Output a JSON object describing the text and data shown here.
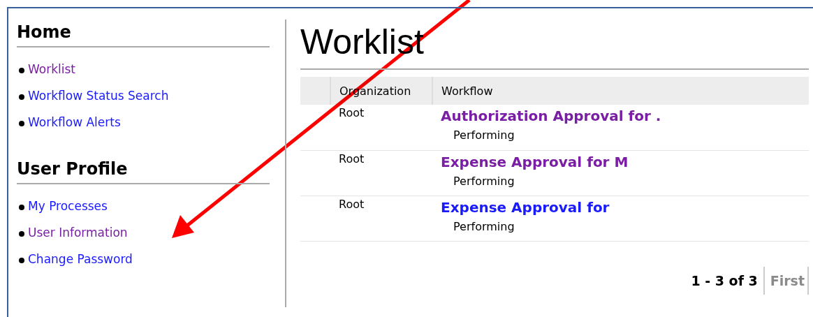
{
  "sidebar": {
    "sections": [
      {
        "heading": "Home",
        "links": [
          {
            "label": "Worklist",
            "visited": true
          },
          {
            "label": "Workflow Status Search",
            "visited": false
          },
          {
            "label": "Workflow Alerts",
            "visited": false
          }
        ]
      },
      {
        "heading": "User Profile",
        "links": [
          {
            "label": "My Processes",
            "visited": false
          },
          {
            "label": "User Information",
            "visited": true
          },
          {
            "label": "Change Password",
            "visited": false
          }
        ]
      }
    ]
  },
  "main": {
    "title": "Worklist",
    "table": {
      "columns": [
        "Organization",
        "Workflow"
      ],
      "rows": [
        {
          "organization": "Root",
          "workflow": "Authorization Approval for .",
          "visited": true,
          "status": "Performing"
        },
        {
          "organization": "Root",
          "workflow": "Expense Approval for M",
          "visited": true,
          "status": "Performing"
        },
        {
          "organization": "Root",
          "workflow": "Expense Approval for",
          "visited": false,
          "status": "Performing"
        }
      ]
    },
    "pagination": {
      "range": "1 - 3 of 3",
      "first": {
        "label": "First",
        "disabled": true
      }
    }
  }
}
